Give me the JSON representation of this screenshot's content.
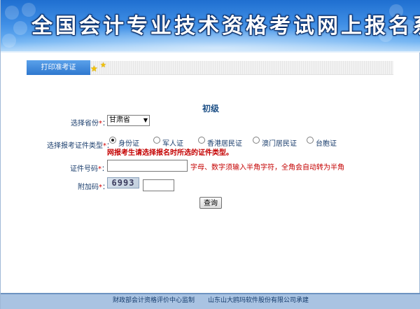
{
  "header": {
    "title": "全国会计专业技术资格考试网上报名系统"
  },
  "nav": {
    "tab_label": "打印准考证"
  },
  "form": {
    "level": "初级",
    "province_label": "选择省份",
    "province_value": "甘肃省",
    "id_type_label": "选择报考证件类型",
    "id_types": [
      "身份证",
      "军人证",
      "香港居民证",
      "澳门居民证",
      "台胞证"
    ],
    "id_type_selected": "身份证",
    "id_type_warning": "网报考生请选择报名时所选的证件类型。",
    "id_number_label": "证件号码",
    "id_number_value": "",
    "id_number_hint": "字母、数字须输入半角字符，全角会自动转为半角",
    "captcha_label": "附加码",
    "captcha_text": "6993",
    "captcha_value": "",
    "required_mark": "*",
    "colon": "：",
    "submit_label": "查询"
  },
  "footer": {
    "left": "财政部会计资格评价中心监制",
    "right": "山东山大鸥玛软件股份有限公司承建"
  },
  "colors": {
    "banner_top": "#1f6fd0",
    "tab_blue": "#2f78cf",
    "required_red": "#d40000",
    "footer_bg": "#a9c3e2"
  }
}
